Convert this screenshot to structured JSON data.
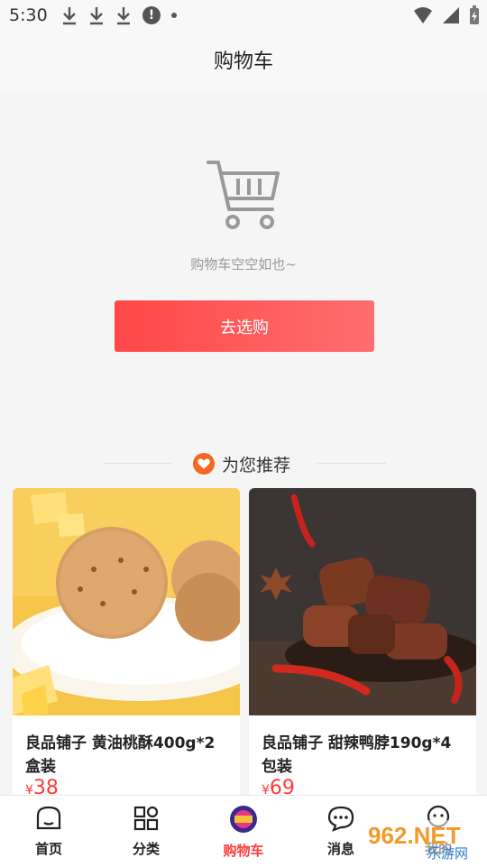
{
  "status_bar": {
    "time": "5:30"
  },
  "header": {
    "title": "购物车"
  },
  "empty_cart": {
    "message": "购物车空空如也~",
    "button_label": "去选购"
  },
  "recommend": {
    "title": "为您推荐"
  },
  "products": [
    {
      "name": "良品铺子 黄油桃酥400g*2盒装",
      "price": "38",
      "currency": "¥"
    },
    {
      "name": "良品铺子 甜辣鸭脖190g*4包装",
      "price": "69",
      "currency": "¥"
    }
  ],
  "tabs": [
    {
      "label": "首页",
      "icon": "home-icon"
    },
    {
      "label": "分类",
      "icon": "category-icon"
    },
    {
      "label": "购物车",
      "icon": "cart-promo-icon",
      "active": true
    },
    {
      "label": "消息",
      "icon": "message-icon"
    },
    {
      "label": "我的",
      "icon": "profile-icon"
    }
  ],
  "watermark": {
    "text": "962.NET",
    "subtitle": "乐游网"
  },
  "colors": {
    "accent": "#ff4748",
    "heart": "#f5661f"
  }
}
